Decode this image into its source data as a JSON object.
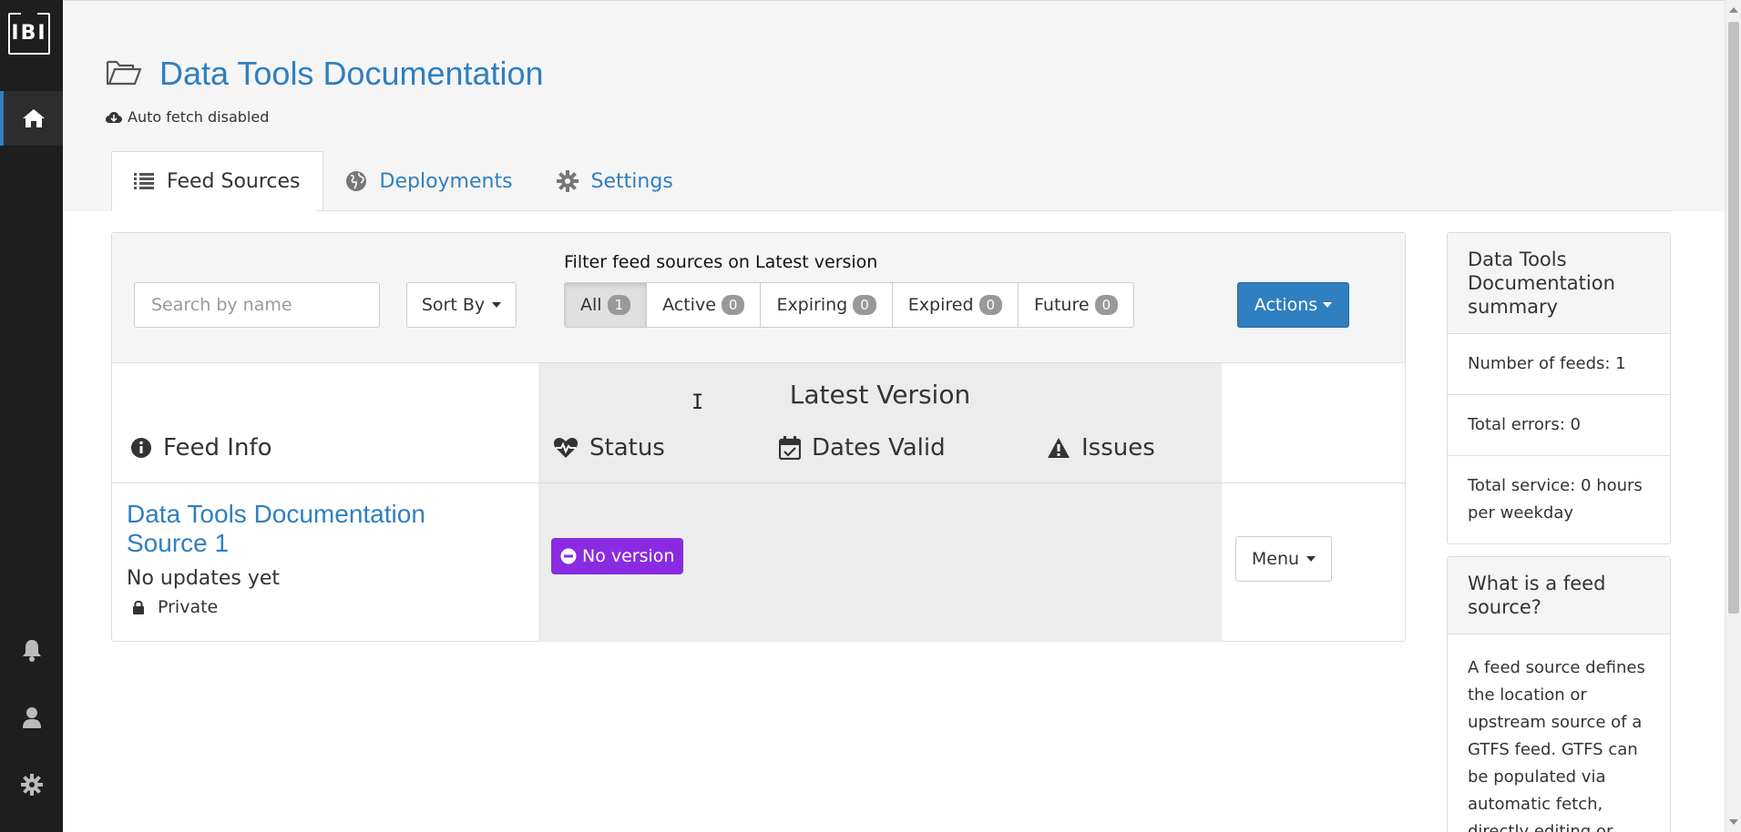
{
  "sidebar": {
    "logo_text": "IBI",
    "icons": [
      "home-icon",
      "bell-icon",
      "user-icon",
      "gear-icon"
    ]
  },
  "project": {
    "title": "Data Tools Documentation",
    "autofetch": "Auto fetch disabled"
  },
  "tabs": [
    {
      "label": "Feed Sources",
      "icon": "list-icon"
    },
    {
      "label": "Deployments",
      "icon": "globe-icon"
    },
    {
      "label": "Settings",
      "icon": "gear-icon"
    }
  ],
  "toolbar": {
    "search_placeholder": "Search by name",
    "sort_label": "Sort By",
    "filter_label": "Filter feed sources on Latest version",
    "filters": [
      {
        "label": "All",
        "count": "1"
      },
      {
        "label": "Active",
        "count": "0"
      },
      {
        "label": "Expiring",
        "count": "0"
      },
      {
        "label": "Expired",
        "count": "0"
      },
      {
        "label": "Future",
        "count": "0"
      }
    ],
    "actions_label": "Actions"
  },
  "table": {
    "group_header": "Latest Version",
    "headers": {
      "feed_info": "Feed Info",
      "status": "Status",
      "dates_valid": "Dates Valid",
      "issues": "Issues"
    },
    "rows": [
      {
        "name": "Data Tools Documentation Source 1",
        "updates": "No updates yet",
        "visibility": "Private",
        "status_badge": "No version",
        "menu_label": "Menu"
      }
    ]
  },
  "summary": {
    "title": "Data Tools Documentation summary",
    "items": [
      "Number of feeds: 1",
      "Total errors: 0",
      "Total service: 0 hours per weekday"
    ]
  },
  "help": {
    "title": "What is a feed source?",
    "body": "A feed source defines the location or upstream source of a GTFS feed. GTFS can be populated via automatic fetch, directly editing or"
  },
  "colors": {
    "accent": "#2f7fc1",
    "sidebar": "#1e1e1e",
    "no_version_badge": "#8a2be2"
  }
}
